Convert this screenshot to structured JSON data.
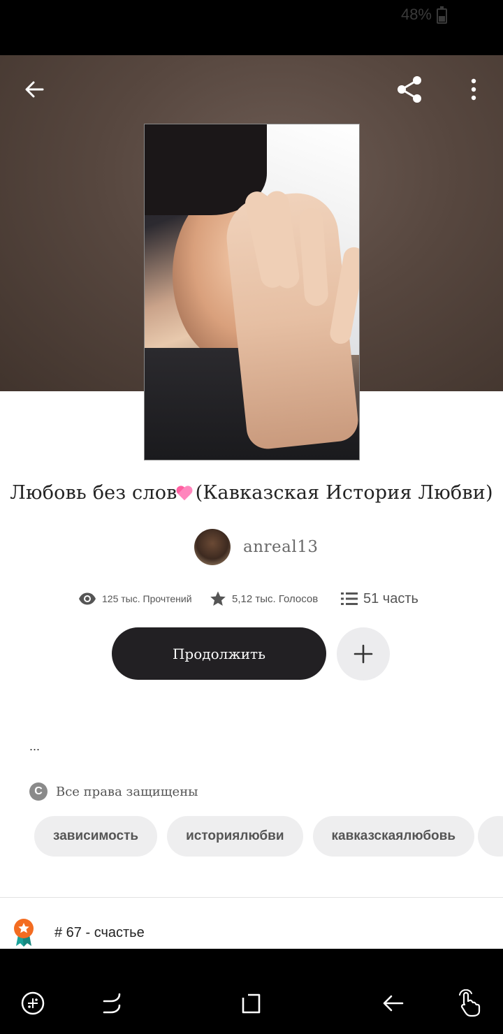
{
  "status_bar": {
    "battery_percent": "48%"
  },
  "header": {
    "back_icon": "arrow-left-icon",
    "share_icon": "share-icon",
    "more_icon": "more-vertical-icon"
  },
  "story": {
    "title_text": "Любовь без слов",
    "title_emoji": "heart-emoji",
    "title_suffix": "(Кавказская История Любви)",
    "author": "anreal13",
    "reads": "125 тыс. Прочтений",
    "votes": "5,12 тыс. Голосов",
    "parts": "51 часть",
    "continue_label": "Продолжить",
    "description": "...",
    "rights": "Все права защищены",
    "tags": [
      "зависимость",
      "историялюбви",
      "кавказскаялюбовь"
    ],
    "rank": "# 67 - счастье"
  },
  "nav_bar": {
    "icons": [
      "game-launcher-icon",
      "recent-apps-icon",
      "home-icon",
      "back-icon",
      "assistant-touch-icon"
    ]
  },
  "colors": {
    "dark_button": "#222023",
    "tag_bg": "#eeeeef",
    "rank_badge": "#f36c21"
  }
}
